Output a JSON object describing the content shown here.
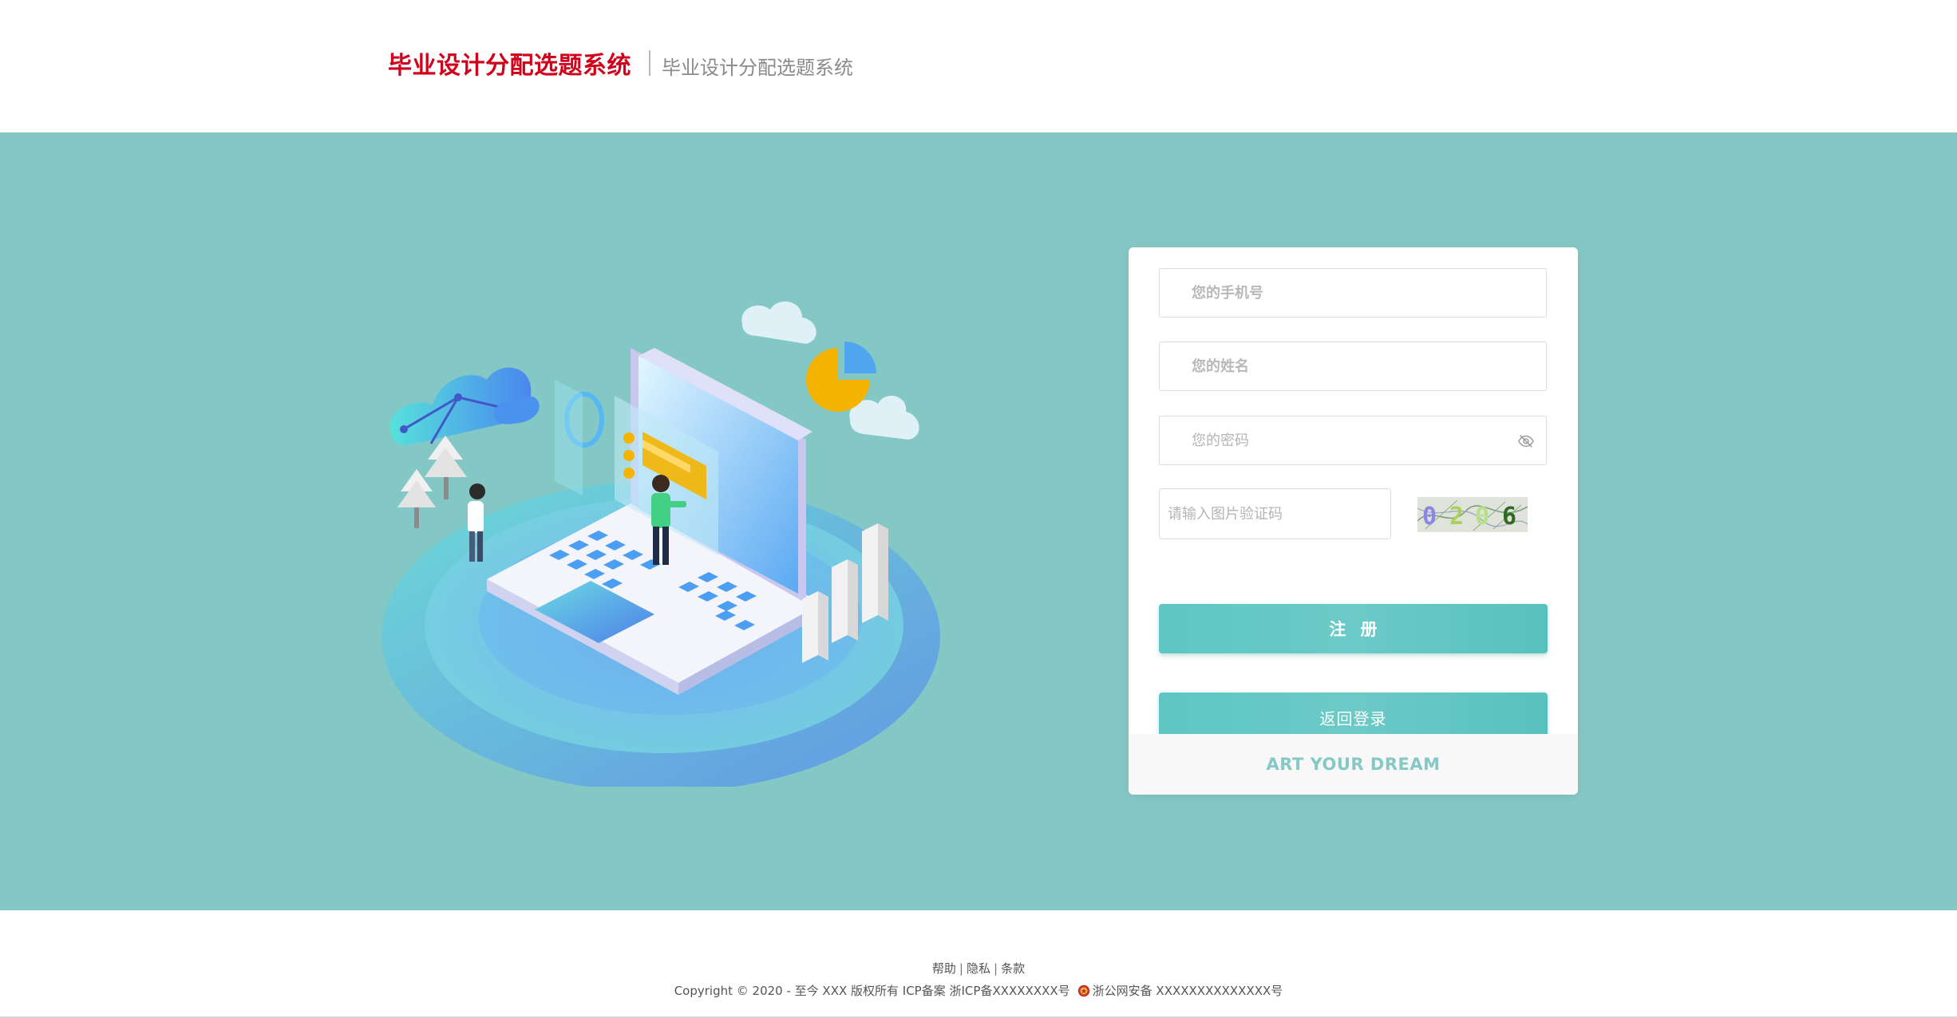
{
  "header": {
    "title": "毕业设计分配选题系统",
    "subtitle": "毕业设计分配选题系统"
  },
  "form": {
    "phone_placeholder": "您的手机号",
    "name_placeholder": "您的姓名",
    "password_placeholder": "您的密码",
    "captcha_placeholder": "请输入图片验证码",
    "captcha_code": "0206",
    "register_label": "注册",
    "back_login_label": "返回登录",
    "slogan": "ART YOUR DREAM"
  },
  "footer": {
    "links": [
      "帮助",
      "隐私",
      "条款"
    ],
    "copyright": "Copyright © 2020 - 至今 XXX 版权所有 ICP备案 浙ICP备XXXXXXXX号",
    "police": "浙公网安备 XXXXXXXXXXXXXX号"
  },
  "colors": {
    "brand_red": "#d0021b",
    "band_teal": "#84c8c6",
    "button_teal": "#5fc6c3",
    "slogan_teal": "#86c8c5"
  },
  "icons": [
    "eye-hidden-icon",
    "police-badge-icon"
  ]
}
